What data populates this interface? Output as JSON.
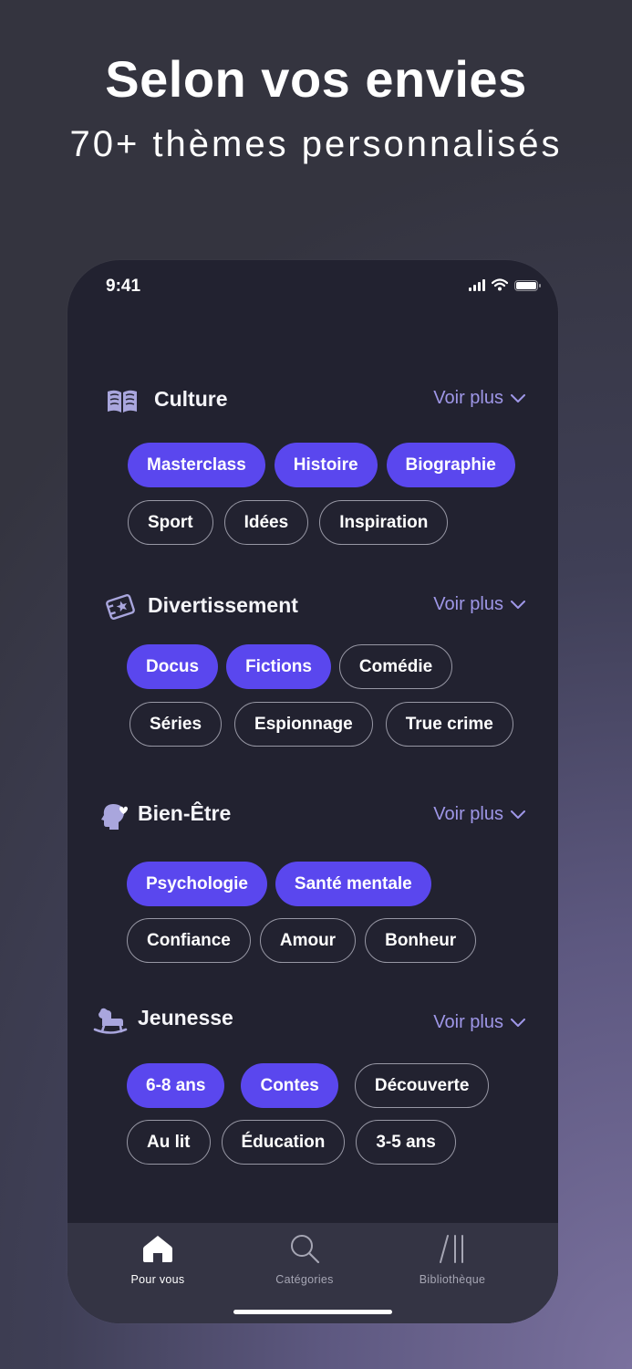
{
  "headline": "Selon vos envies",
  "subheadline": "70+ thèmes personnalisés",
  "status_bar": {
    "time": "9:41"
  },
  "voir_plus_label": "Voir plus",
  "sections": [
    {
      "title": "Culture",
      "icon": "book-icon",
      "rows": [
        [
          {
            "label": "Masterclass",
            "selected": true
          },
          {
            "label": "Histoire",
            "selected": true
          },
          {
            "label": "Biographie",
            "selected": true
          }
        ],
        [
          {
            "label": "Sport",
            "selected": false
          },
          {
            "label": "Idées",
            "selected": false
          },
          {
            "label": "Inspiration",
            "selected": false
          }
        ]
      ]
    },
    {
      "title": "Divertissement",
      "icon": "ticket-star-icon",
      "rows": [
        [
          {
            "label": "Docus",
            "selected": true
          },
          {
            "label": "Fictions",
            "selected": true
          },
          {
            "label": "Comédie",
            "selected": false
          }
        ],
        [
          {
            "label": "Séries",
            "selected": false
          },
          {
            "label": "Espionnage",
            "selected": false
          },
          {
            "label": "True crime",
            "selected": false
          }
        ]
      ]
    },
    {
      "title": "Bien-Être",
      "icon": "head-heart-icon",
      "rows": [
        [
          {
            "label": "Psychologie",
            "selected": true
          },
          {
            "label": "Santé mentale",
            "selected": true
          }
        ],
        [
          {
            "label": "Confiance",
            "selected": false
          },
          {
            "label": "Amour",
            "selected": false
          },
          {
            "label": "Bonheur",
            "selected": false
          }
        ]
      ]
    },
    {
      "title": "Jeunesse",
      "icon": "rocking-horse-icon",
      "rows": [
        [
          {
            "label": "6-8 ans",
            "selected": true
          },
          {
            "label": "Contes",
            "selected": true
          },
          {
            "label": "Découverte",
            "selected": false
          }
        ],
        [
          {
            "label": "Au lit",
            "selected": false
          },
          {
            "label": "Éducation",
            "selected": false
          },
          {
            "label": "3-5 ans",
            "selected": false
          }
        ]
      ]
    }
  ],
  "tabbar": {
    "tabs": [
      {
        "label": "Pour vous",
        "icon": "home-icon",
        "active": true
      },
      {
        "label": "Catégories",
        "icon": "search-icon",
        "active": false
      },
      {
        "label": "Bibliothèque",
        "icon": "library-icon",
        "active": false
      }
    ]
  },
  "colors": {
    "accent": "#5a47ee",
    "link": "#9f97e8",
    "icon_tint": "#a9a6dd",
    "screen_bg": "#222230",
    "tabbar_bg": "#343444"
  }
}
